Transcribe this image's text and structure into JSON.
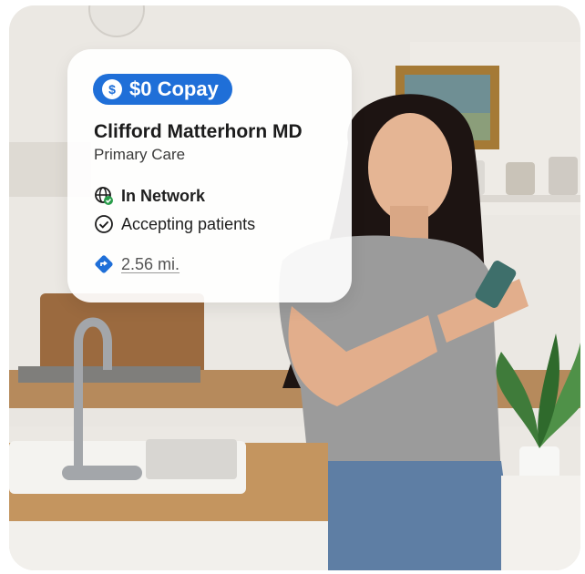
{
  "card": {
    "copay_label": "$0 Copay",
    "copay_icon": "dollar-coin-icon",
    "provider_name": "Clifford Matterhorn MD",
    "specialty": "Primary Care",
    "network_status": "In Network",
    "network_icon": "globe-check-icon",
    "accepting_status": "Accepting patients",
    "accepting_icon": "check-circle-icon",
    "distance": "2.56 mi.",
    "distance_icon": "directions-icon"
  },
  "colors": {
    "accent": "#1f6fd8",
    "text_primary": "#1c1c1c",
    "check_green": "#2a9d4b"
  },
  "scene": {
    "type": "photo",
    "subject_icon": "woman-using-phone-in-kitchen"
  }
}
